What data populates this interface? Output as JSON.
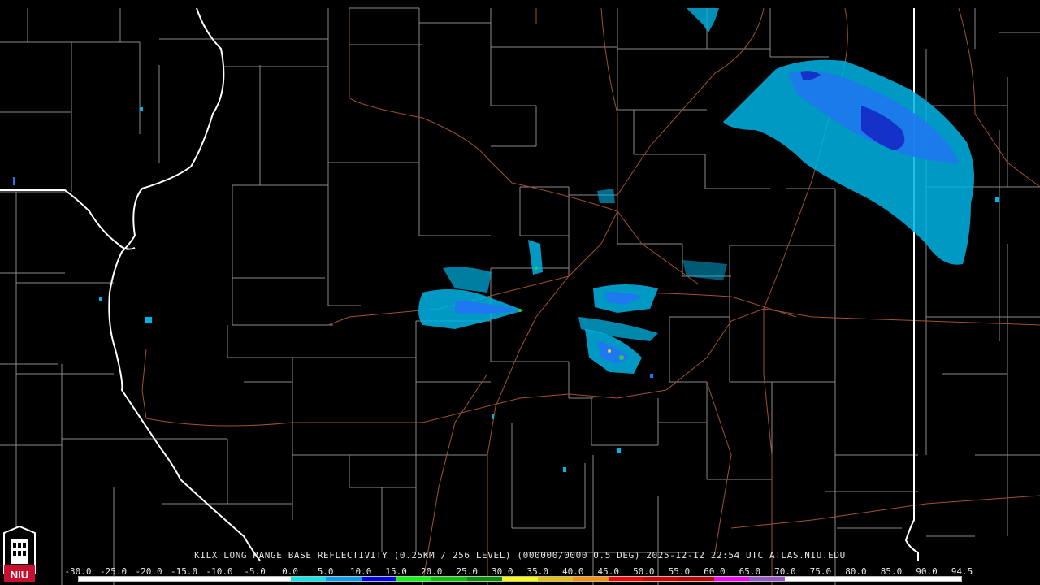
{
  "product_title": "KILX LONG RANGE BASE REFLECTIVITY (0.25KM / 256 LEVEL) (000000/0000 0.5 DEG) 2025-12-12 22:54 UTC  ATLAS.NIU.EDU",
  "logo_text": "NIU",
  "colors": {
    "background": "#000000",
    "county_lines": "#8a8a8a",
    "state_lines": "#ffffff",
    "roads": "#a0522d"
  },
  "scale": {
    "labels": [
      "-30.0",
      "-25.0",
      "-20.0",
      "-15.0",
      "-10.0",
      "-5.0",
      "0.0",
      "5.0",
      "10.0",
      "15.0",
      "20.0",
      "25.0",
      "30.0",
      "35.0",
      "40.0",
      "45.0",
      "50.0",
      "55.0",
      "60.0",
      "65.0",
      "70.0",
      "75.0",
      "80.0",
      "85.0",
      "90.0",
      "94.5"
    ],
    "colors": [
      "#ffffff",
      "#ffffff",
      "#ffffff",
      "#ffffff",
      "#ffffff",
      "#ffffff",
      "#00ecec",
      "#01a0f6",
      "#0000f6",
      "#00ff00",
      "#00c800",
      "#009000",
      "#ffff00",
      "#e7c000",
      "#ff9000",
      "#ff0000",
      "#d60000",
      "#c00000",
      "#ff00ff",
      "#9955c9",
      "#ffffff",
      "#ffffff",
      "#ffffff",
      "#ffffff",
      "#ffffff"
    ]
  }
}
